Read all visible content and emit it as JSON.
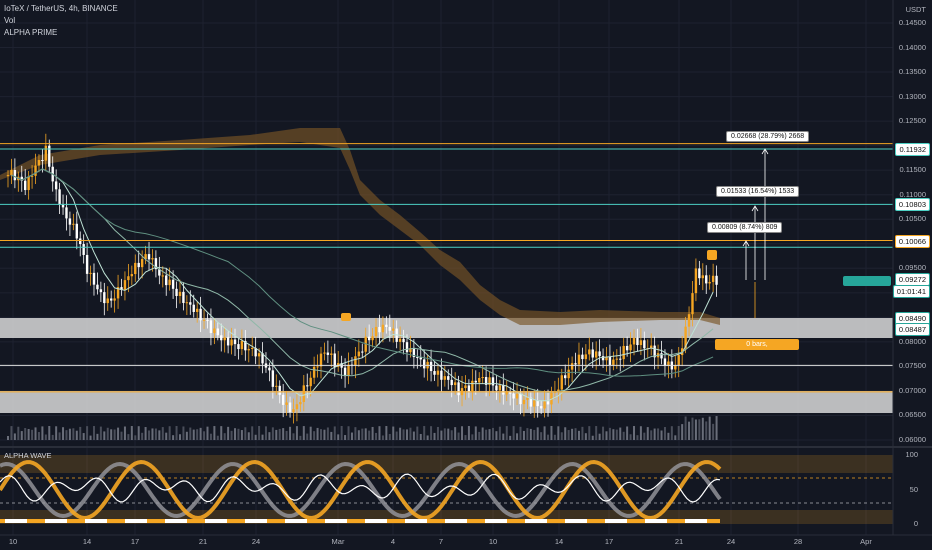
{
  "header": {
    "symbol_line": "IoTeX / TetherUS, 4h, BINANCE",
    "indicator_1": "Vol",
    "indicator_2": "ALPHA PRIME"
  },
  "price_axis": {
    "currency": "USDT",
    "ticks": [
      "0.14500",
      "0.14000",
      "0.13500",
      "0.13000",
      "0.12500",
      "0.12000",
      "0.11500",
      "0.11000",
      "0.10500",
      "0.10000",
      "0.09500",
      "0.09000",
      "0.08500",
      "0.08000",
      "0.07500",
      "0.07000",
      "0.06500",
      "0.06000"
    ],
    "tags": [
      {
        "label": "0.11932",
        "bg": "#ffffff",
        "fg": "#111111",
        "border": "#4dd0c4",
        "value": 0.11932
      },
      {
        "label": "0.10803",
        "bg": "#ffffff",
        "fg": "#111111",
        "border": "#4dd0c4",
        "value": 0.10803
      },
      {
        "label": "0.10066",
        "bg": "#ffffff",
        "fg": "#111111",
        "border": "#f5a623",
        "value": 0.10066
      },
      {
        "label": "0.09272",
        "bg": "#ffffff",
        "fg": "#111111",
        "border": "#26a69a",
        "value": 0.09272
      },
      {
        "label": "01:01:41",
        "bg": "#ffffff",
        "fg": "#111111",
        "border": "#26a69a",
        "value": 0.09045
      },
      {
        "label": "0.08490",
        "bg": "#ffffff",
        "fg": "#111111",
        "border": "#26a69a",
        "value": 0.0849
      },
      {
        "label": "0.08487",
        "bg": "#ffffff",
        "fg": "#111111",
        "border": "#26a69a",
        "value": 0.0827
      }
    ]
  },
  "osc_axis": {
    "ticks": [
      "100",
      "50",
      "0"
    ]
  },
  "oscillator": {
    "name": "ALPHA WAVE"
  },
  "date_axis": [
    "10",
    "14",
    "17",
    "21",
    "24",
    "Mar",
    "4",
    "7",
    "10",
    "14",
    "17",
    "21",
    "24",
    "28",
    "Apr"
  ],
  "measurements": [
    {
      "label": "0.02668 (28.79%) 2668"
    },
    {
      "label": "0.01533 (16.54%) 1533"
    },
    {
      "label": "0.00809 (8.74%) 809"
    }
  ],
  "bars_box": {
    "label": "0 bars,"
  },
  "colors": {
    "background": "#131722",
    "orange": "#f5a623",
    "teal": "#4dd0c4",
    "band": "#7a5526",
    "up": "#f5a623",
    "down": "#ffffff"
  },
  "chart_data": {
    "type": "candlestick",
    "price_range": [
      0.058,
      0.148
    ],
    "horizontal_levels": [
      0.11932,
      0.10803,
      0.10066,
      0.0849,
      0.0752,
      0.0678
    ],
    "close_series": [
      0.114,
      0.112,
      0.116,
      0.119,
      0.11,
      0.105,
      0.102,
      0.095,
      0.091,
      0.088,
      0.09,
      0.093,
      0.096,
      0.098,
      0.094,
      0.092,
      0.089,
      0.087,
      0.085,
      0.083,
      0.081,
      0.08,
      0.079,
      0.078,
      0.076,
      0.072,
      0.068,
      0.066,
      0.07,
      0.074,
      0.078,
      0.076,
      0.074,
      0.077,
      0.08,
      0.082,
      0.083,
      0.081,
      0.079,
      0.077,
      0.075,
      0.073,
      0.072,
      0.07,
      0.071,
      0.073,
      0.072,
      0.07,
      0.069,
      0.068,
      0.068,
      0.067,
      0.069,
      0.072,
      0.075,
      0.077,
      0.078,
      0.077,
      0.076,
      0.078,
      0.08,
      0.079,
      0.078,
      0.076,
      0.075,
      0.082,
      0.094,
      0.092,
      0.0927
    ]
  }
}
